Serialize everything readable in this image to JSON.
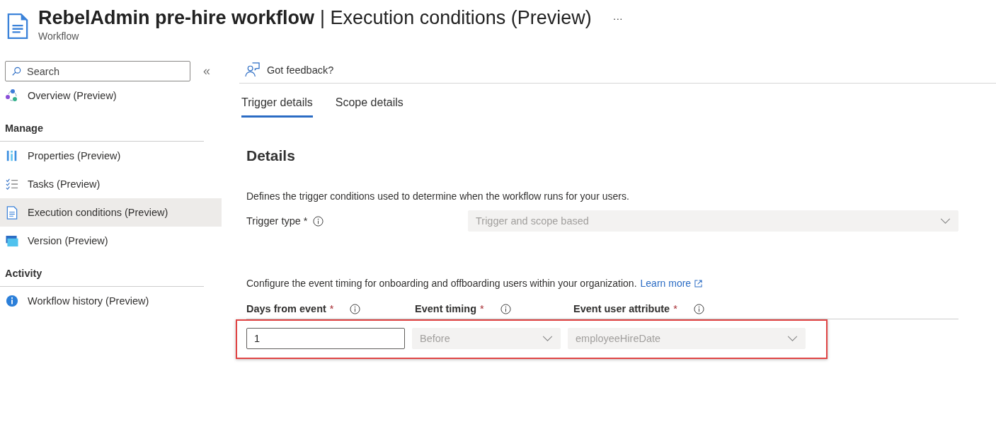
{
  "header": {
    "title": "RebelAdmin pre-hire workflow",
    "subtitle_part": "| Execution conditions (Preview)",
    "caption": "Workflow",
    "more": "···"
  },
  "sidebar": {
    "search": {
      "placeholder": "Search"
    },
    "collapse": "«",
    "sections": [
      {
        "items": [
          {
            "label": "Overview (Preview)",
            "kind": "overview",
            "selected": false
          }
        ]
      },
      {
        "heading": "Manage",
        "items": [
          {
            "label": "Properties (Preview)",
            "kind": "properties",
            "selected": false
          },
          {
            "label": "Tasks (Preview)",
            "kind": "tasks",
            "selected": false
          },
          {
            "label": "Execution conditions (Preview)",
            "kind": "document",
            "selected": true
          },
          {
            "label": "Version (Preview)",
            "kind": "version",
            "selected": false
          }
        ]
      },
      {
        "heading": "Activity",
        "items": [
          {
            "label": "Workflow history (Preview)",
            "kind": "info",
            "selected": false
          }
        ]
      }
    ]
  },
  "toolbar": {
    "feedback": "Got feedback?"
  },
  "tabs": [
    {
      "label": "Trigger details",
      "selected": true
    },
    {
      "label": "Scope details",
      "selected": false
    }
  ],
  "details": {
    "heading": "Details",
    "description": "Defines the trigger conditions used to determine when the workflow runs for your users.",
    "trigger_type": {
      "label": "Trigger type *",
      "value": "Trigger and scope based",
      "disabled": true
    },
    "timing_text": "Configure the event timing for onboarding and offboarding users within your organization.",
    "learn_more": "Learn more",
    "fields": [
      {
        "label": "Days from event",
        "required": "*",
        "kind": "input",
        "value": "1",
        "disabled": false
      },
      {
        "label": "Event timing",
        "required": "*",
        "kind": "select",
        "value": "Before",
        "disabled": true
      },
      {
        "label": "Event user attribute",
        "required": "*",
        "kind": "select",
        "value": "employeeHireDate",
        "disabled": true
      }
    ]
  }
}
